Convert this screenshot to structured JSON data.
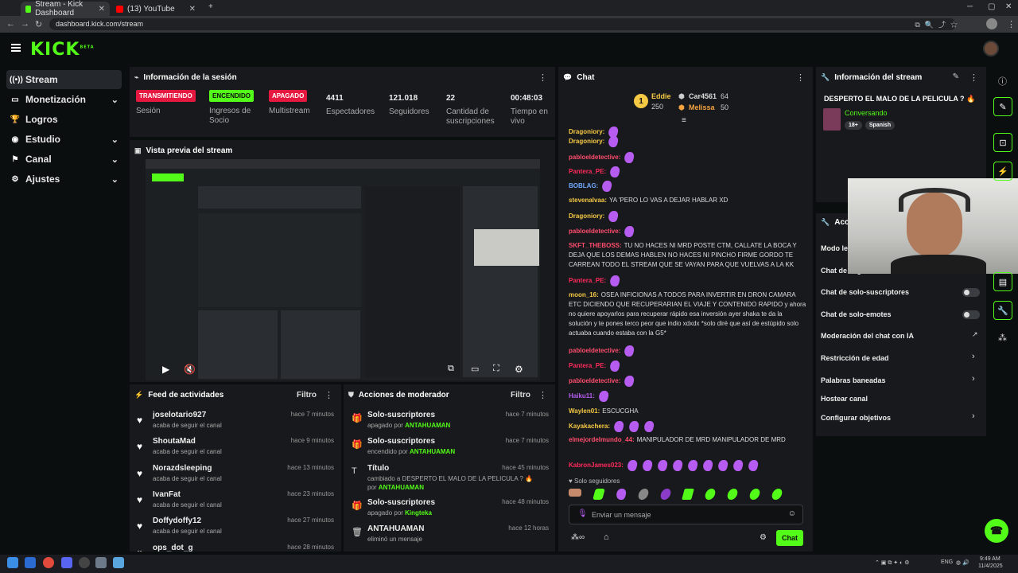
{
  "browser": {
    "tabs": [
      {
        "title": "Stream - Kick Dashboard",
        "active": true,
        "favicon_color": "#53fc18"
      },
      {
        "title": "(13) YouTube",
        "active": false,
        "favicon_color": "#ff0000"
      }
    ],
    "url": "dashboard.kick.com/stream"
  },
  "brand": {
    "logo": "KICK",
    "logo_sup": "BETA",
    "accent": "#53fc18"
  },
  "sidebar": {
    "items": [
      {
        "label": "Stream",
        "icon": "broadcast-icon",
        "active": true,
        "chevron": false
      },
      {
        "label": "Monetización",
        "icon": "money-icon",
        "active": false,
        "chevron": true
      },
      {
        "label": "Logros",
        "icon": "trophy-icon",
        "active": false,
        "chevron": false
      },
      {
        "label": "Estudio",
        "icon": "studio-icon",
        "active": false,
        "chevron": true
      },
      {
        "label": "Canal",
        "icon": "flag-icon",
        "active": false,
        "chevron": true
      },
      {
        "label": "Ajustes",
        "icon": "gear-icon",
        "active": false,
        "chevron": true
      }
    ]
  },
  "session": {
    "title": "Información de la sesión",
    "stats": [
      {
        "badge": "TRANSMITIENDO",
        "badge_color": "#e5193f",
        "label": "Sesión"
      },
      {
        "badge": "ENCENDIDO",
        "badge_color": "#53fc18",
        "label": "Ingresos de Socio"
      },
      {
        "badge": "APAGADO",
        "badge_color": "#e5193f",
        "label": "Multistream"
      },
      {
        "value": "4411",
        "label": "Espectadores"
      },
      {
        "value": "121.018",
        "label": "Seguidores"
      },
      {
        "value": "22",
        "label": "Cantidad de suscripciones"
      },
      {
        "value": "00:48:03",
        "label": "Tiempo en vivo"
      }
    ]
  },
  "preview": {
    "title": "Vista previa del stream"
  },
  "feed": {
    "title": "Feed de actividades",
    "filter_label": "Filtro",
    "items": [
      {
        "name": "joselotario927",
        "sub": "acaba de seguir el canal",
        "time": "hace 7 minutos"
      },
      {
        "name": "ShoutaMad",
        "sub": "acaba de seguir el canal",
        "time": "hace 9 minutos"
      },
      {
        "name": "Norazdsleeping",
        "sub": "acaba de seguir el canal",
        "time": "hace 13 minutos"
      },
      {
        "name": "IvanFat",
        "sub": "acaba de seguir el canal",
        "time": "hace 23 minutos"
      },
      {
        "name": "Doffydoffy12",
        "sub": "acaba de seguir el canal",
        "time": "hace 27 minutos"
      },
      {
        "name": "ops_dot_g",
        "sub": "",
        "time": "hace 28 minutos"
      }
    ]
  },
  "mod": {
    "title": "Acciones de moderador",
    "filter_label": "Filtro",
    "items": [
      {
        "name": "Solo-suscriptores",
        "sub_pre": "apagado por ",
        "sub_user": "ANTAHUAMAN",
        "sub_post": "",
        "time": "hace 7 minutos"
      },
      {
        "name": "Solo-suscriptores",
        "sub_pre": "encendido por ",
        "sub_user": "ANTAHUAMAN",
        "sub_post": "",
        "time": "hace 7 minutos"
      },
      {
        "name": "Título",
        "sub_pre": "cambiado a DESPERTO EL MALO DE LA PELICULA ? 🔥 por ",
        "sub_user": "ANTAHUAMAN",
        "sub_post": "",
        "time": "hace 45 minutos"
      },
      {
        "name": "Solo-suscriptores",
        "sub_pre": "apagado por ",
        "sub_user": "Kingteka",
        "sub_post": "",
        "time": "hace 48 minutos"
      },
      {
        "name": "ANTAHUAMAN",
        "sub_pre": "eliminó un mensaje",
        "sub_user": "",
        "sub_post": "",
        "time": "hace 12 horas"
      }
    ]
  },
  "chat": {
    "title": "Chat",
    "top": [
      {
        "name": "Eddie",
        "value": "250",
        "rank": "1",
        "color": "#f6c945"
      },
      {
        "name": "Car4561",
        "value": "64",
        "color": "#bbbbbb"
      },
      {
        "name": "Melissa",
        "value": "50",
        "color": "#f4a340"
      }
    ],
    "messages": [
      {
        "user": "Dragoniory:",
        "color": "#f6c945",
        "text": "",
        "emotes": 1
      },
      {
        "user": "Dragoniory:",
        "color": "#f6c945",
        "text": "",
        "emotes": 1
      },
      {
        "user": "pabloeldetective:",
        "color": "#ff4d6d",
        "text": "",
        "emotes": 1
      },
      {
        "user": "Pantera_PE:",
        "color": "#ff2a5c",
        "text": "",
        "emotes": 1
      },
      {
        "user": "BOBLAG:",
        "color": "#6fa8ff",
        "text": "",
        "emotes": 1
      },
      {
        "user": "stevenalvaa:",
        "color": "#f6c945",
        "text": "YA 'PERO LO VAS A DEJAR HABLAR XD",
        "emotes": 0
      },
      {
        "user": "Dragoniory:",
        "color": "#f6c945",
        "text": "",
        "emotes": 1
      },
      {
        "user": "pabloeldetective:",
        "color": "#ff4d6d",
        "text": "",
        "emotes": 1
      },
      {
        "user": "SKFT_THEBOSS:",
        "color": "#ff4d6d",
        "text": "TU NO HACES NI MRD POSTE CTM, CALLATE LA BOCA Y DEJA QUE LOS DEMAS HABLEN NO HACES NI PINCHO FIRME GORDO TE CARREAN TODO EL STREAM QUE SE VAYAN PARA QUE VUELVAS A LA KK",
        "emotes": 0
      },
      {
        "user": "Pantera_PE:",
        "color": "#ff2a5c",
        "text": "",
        "emotes": 1
      },
      {
        "user": "moon_16:",
        "color": "#f6c945",
        "text": "OSEA INFICIONAS A TODOS PARA INVERTIR EN DRON CAMARA ETC DICIENDO QUE RECUPERARIAN EL VIAJE Y CONTENIDO RAPIDO y ahora no quiere apoyarlos para recuperar rápido esa inversión ayer shaka te da la solución y te pones terco peor que indio xdxdx *solo diré que así de estúpido solo actuaba cuando estaba con la G5*",
        "emotes": 0
      },
      {
        "user": "pabloeldetective:",
        "color": "#ff4d6d",
        "text": "",
        "emotes": 1
      },
      {
        "user": "Pantera_PE:",
        "color": "#ff2a5c",
        "text": "",
        "emotes": 1
      },
      {
        "user": "pabloeldetective:",
        "color": "#ff4d6d",
        "text": "",
        "emotes": 1
      },
      {
        "user": "Haiku11:",
        "color": "#b65cf0",
        "text": "",
        "emotes": 1
      },
      {
        "user": "Waylen01:",
        "color": "#f6c945",
        "text": "ESCUCGHA",
        "emotes": 0
      },
      {
        "user": "Kayakachera:",
        "color": "#f6c945",
        "text": "",
        "emotes": 3
      },
      {
        "user": "elmejordelmundo_44:",
        "color": "#ff4d6d",
        "text": "MANIPULADOR DE MRD MANIPULADOR DE MRD",
        "emotes": 0
      },
      {
        "user": "KabronJames023:",
        "color": "#ff2a5c",
        "text": "",
        "emotes": 9
      }
    ],
    "followers_only": "Solo seguidores",
    "input_placeholder": "Enviar un mensaje",
    "send_label": "Chat"
  },
  "stream_info": {
    "title": "Información del stream",
    "stream_title": "DESPERTO EL MALO DE LA PELICULA ? 🔥",
    "category": "Conversando",
    "tags": [
      "18+",
      "Spanish"
    ]
  },
  "chat_actions": {
    "title": "Acciones del chat",
    "rows": [
      {
        "label": "Modo lento",
        "control": "none"
      },
      {
        "label": "Chat de seguidores",
        "control": "none"
      },
      {
        "label": "Chat de solo-suscriptores",
        "control": "toggle"
      },
      {
        "label": "Chat de solo-emotes",
        "control": "toggle"
      },
      {
        "label": "Moderación del chat con IA",
        "control": "external"
      },
      {
        "label": "Restricción de edad",
        "control": "chevron"
      },
      {
        "label": "Palabras baneadas",
        "control": "chevron"
      },
      {
        "label": "Hostear canal",
        "control": "none"
      },
      {
        "label": "Configurar objetivos",
        "control": "chevron"
      }
    ]
  },
  "taskbar": {
    "lang": "ENG",
    "time": "9:49 AM",
    "date": "11/4/2025"
  }
}
